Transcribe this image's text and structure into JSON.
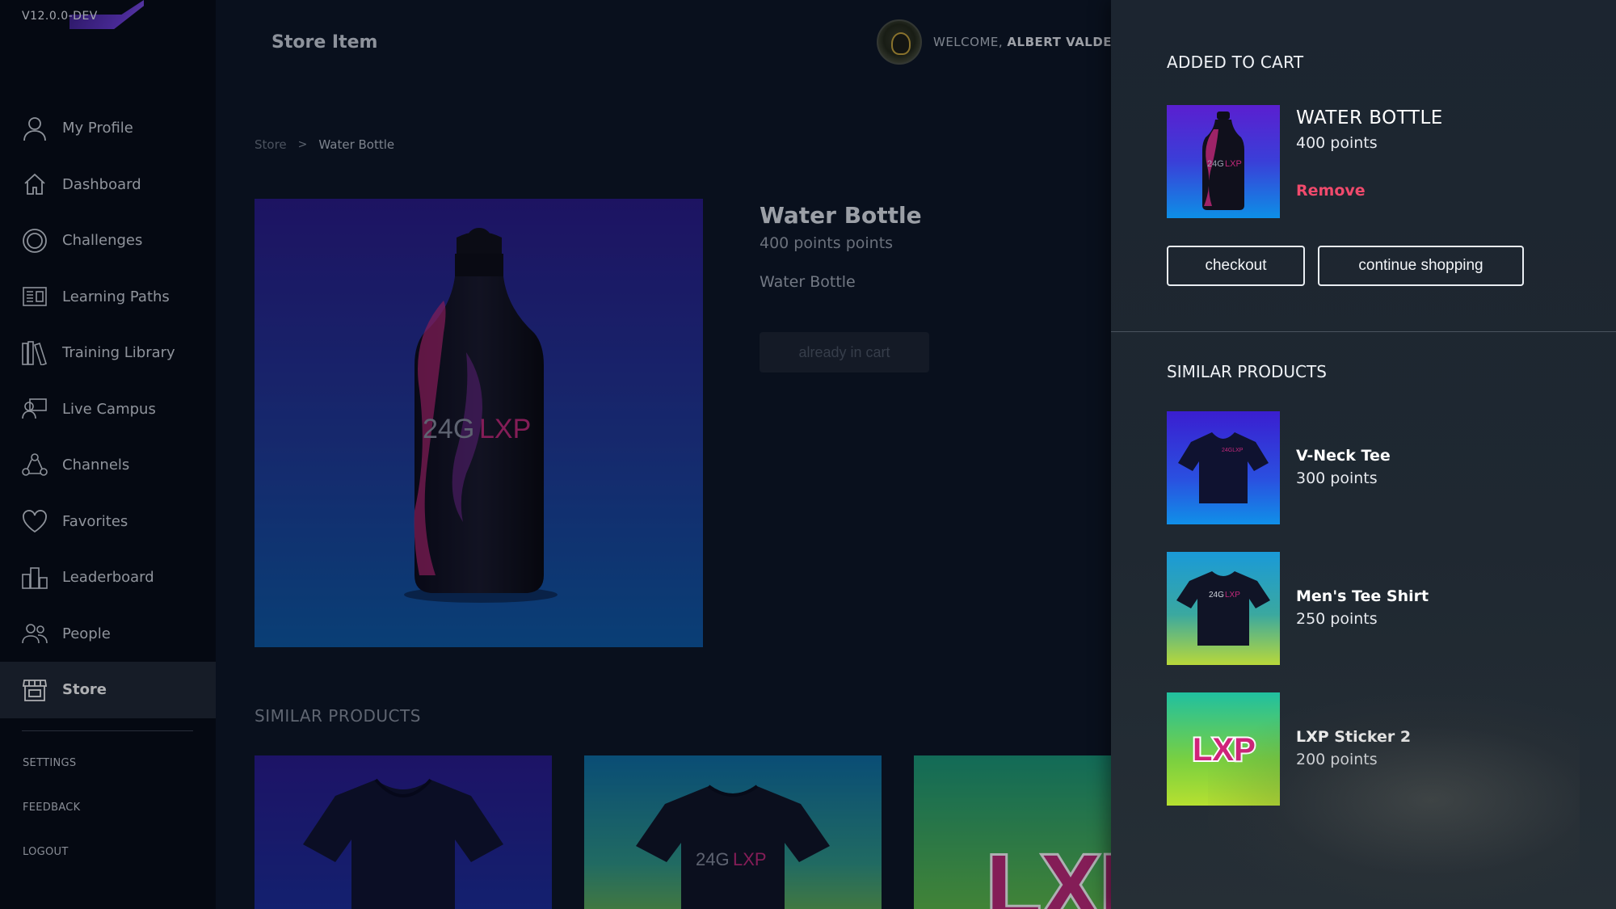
{
  "version": "V12.0.0-DEV",
  "header": {
    "title": "Store Item",
    "welcome_prefix": "WELCOME,",
    "user_name": "ALBERT VALDES"
  },
  "sidebar": {
    "items": [
      {
        "label": "My Profile",
        "icon": "user-icon"
      },
      {
        "label": "Dashboard",
        "icon": "home-icon"
      },
      {
        "label": "Challenges",
        "icon": "target-icon"
      },
      {
        "label": "Learning Paths",
        "icon": "learning-paths-icon"
      },
      {
        "label": "Training Library",
        "icon": "library-icon"
      },
      {
        "label": "Live Campus",
        "icon": "live-campus-icon"
      },
      {
        "label": "Channels",
        "icon": "channels-icon"
      },
      {
        "label": "Favorites",
        "icon": "heart-icon"
      },
      {
        "label": "Leaderboard",
        "icon": "leaderboard-icon"
      },
      {
        "label": "People",
        "icon": "people-icon"
      },
      {
        "label": "Store",
        "icon": "store-icon",
        "active": true
      }
    ],
    "footer": {
      "settings": "SETTINGS",
      "feedback": "FEEDBACK",
      "logout": "LOGOUT"
    }
  },
  "breadcrumb": {
    "root": "Store",
    "separator": ">",
    "current": "Water Bottle"
  },
  "product": {
    "name": "Water Bottle",
    "points": "400 points points",
    "description": "Water Bottle",
    "button": "already in cart",
    "logo_text": "24G",
    "logo_accent": "LXP"
  },
  "similar_section": {
    "title": "SIMILAR PRODUCTS"
  },
  "cart": {
    "title": "ADDED TO CART",
    "item_name": "WATER BOTTLE",
    "item_points": "400 points",
    "remove_label": "Remove",
    "checkout_label": "checkout",
    "continue_label": "continue shopping"
  },
  "drawer_similar": {
    "title": "SIMILAR PRODUCTS",
    "items": [
      {
        "name": "V-Neck Tee",
        "points": "300 points"
      },
      {
        "name": "Men's Tee Shirt",
        "points": "250 points"
      },
      {
        "name": "LXP Sticker 2",
        "points": "200 points"
      }
    ]
  },
  "colors": {
    "accent_pink": "#f04a6c",
    "sidebar_bg": "#060b14",
    "drawer_bg": "#1f2831",
    "active_nav_bg": "#1f2733"
  }
}
